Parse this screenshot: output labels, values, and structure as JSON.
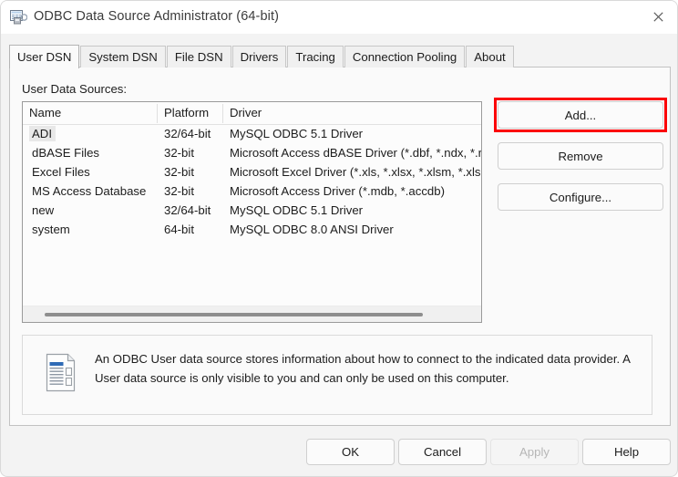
{
  "window": {
    "title": "ODBC Data Source Administrator (64-bit)",
    "icon": "odbc-app-icon",
    "close_icon": "close-icon"
  },
  "tabs": [
    {
      "label": "User DSN",
      "active": true
    },
    {
      "label": "System DSN",
      "active": false
    },
    {
      "label": "File DSN",
      "active": false
    },
    {
      "label": "Drivers",
      "active": false
    },
    {
      "label": "Tracing",
      "active": false
    },
    {
      "label": "Connection Pooling",
      "active": false
    },
    {
      "label": "About",
      "active": false
    }
  ],
  "panel": {
    "section_label": "User Data Sources:",
    "table": {
      "columns": [
        "Name",
        "Platform",
        "Driver"
      ],
      "rows": [
        {
          "name": "ADI",
          "platform": "32/64-bit",
          "driver": "MySQL ODBC 5.1 Driver",
          "selected": true
        },
        {
          "name": "dBASE Files",
          "platform": "32-bit",
          "driver": "Microsoft Access dBASE Driver (*.dbf, *.ndx, *.r",
          "selected": false
        },
        {
          "name": "Excel Files",
          "platform": "32-bit",
          "driver": "Microsoft Excel Driver (*.xls, *.xlsx, *.xlsm, *.xlsb",
          "selected": false
        },
        {
          "name": "MS Access Database",
          "platform": "32-bit",
          "driver": "Microsoft Access Driver (*.mdb, *.accdb)",
          "selected": false
        },
        {
          "name": "new",
          "platform": "32/64-bit",
          "driver": "MySQL ODBC 5.1 Driver",
          "selected": false
        },
        {
          "name": "system",
          "platform": "64-bit",
          "driver": "MySQL ODBC 8.0 ANSI Driver",
          "selected": false
        }
      ]
    },
    "side_buttons": {
      "add": "Add...",
      "remove": "Remove",
      "configure": "Configure..."
    },
    "info": {
      "icon": "data-source-document-icon",
      "text": "An ODBC User data source stores information about how to connect to the indicated data provider.   A User data source is only visible to you and can only be used on this computer."
    }
  },
  "footer": {
    "ok": "OK",
    "cancel": "Cancel",
    "apply": "Apply",
    "help": "Help"
  },
  "annotation": {
    "highlight_target": "Add...",
    "highlight_color": "#fb0007"
  }
}
